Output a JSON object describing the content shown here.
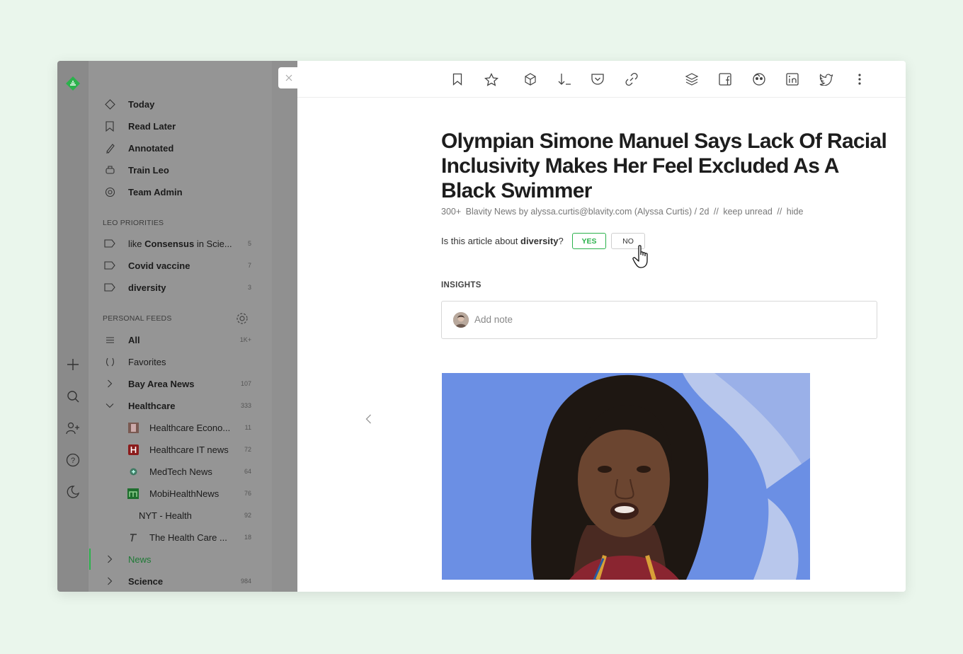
{
  "colors": {
    "accent": "#2bb24c",
    "page_bg": "#eaf6ec"
  },
  "rail": {
    "icons": [
      "feedly-logo-icon",
      "add-icon",
      "search-icon",
      "add-user-icon",
      "help-icon",
      "dark-mode-icon"
    ]
  },
  "sidebar": {
    "top_items": [
      {
        "label": "Today",
        "icon": "today-icon"
      },
      {
        "label": "Read Later",
        "icon": "bookmark-icon"
      },
      {
        "label": "Annotated",
        "icon": "highlighter-icon"
      },
      {
        "label": "Train Leo",
        "icon": "leo-icon"
      },
      {
        "label": "Team Admin",
        "icon": "team-icon"
      }
    ],
    "leo_priorities_title": "LEO PRIORITIES",
    "priorities": [
      {
        "prefix": "like ",
        "bold": "Consensus",
        "suffix": " in Scie...",
        "count": "5"
      },
      {
        "prefix": "",
        "bold": "Covid vaccine",
        "suffix": "",
        "count": "7"
      },
      {
        "prefix": "",
        "bold": "diversity",
        "suffix": "",
        "count": "3"
      }
    ],
    "personal_feeds_title": "PERSONAL FEEDS",
    "feeds": [
      {
        "label": "All",
        "count": "1K+"
      },
      {
        "label": "Favorites",
        "count": ""
      },
      {
        "label": "Bay Area News",
        "count": "107"
      },
      {
        "label": "Healthcare",
        "count": "333"
      },
      {
        "label": "Healthcare Econo...",
        "count": "11"
      },
      {
        "label": "Healthcare IT news",
        "count": "72"
      },
      {
        "label": "MedTech News",
        "count": "64"
      },
      {
        "label": "MobiHealthNews",
        "count": "76"
      },
      {
        "label": "NYT - Health",
        "count": "92"
      },
      {
        "label": "The Health Care ...",
        "count": "18"
      },
      {
        "label": "News",
        "count": ""
      },
      {
        "label": "Science",
        "count": "984"
      }
    ]
  },
  "toolbar": {
    "icons": [
      "bookmark-icon",
      "star-icon",
      "board-icon",
      "mark-read-icon",
      "pocket-icon",
      "link-icon",
      "buffer-icon",
      "facebook-icon",
      "hootsuite-icon",
      "linkedin-icon",
      "twitter-icon",
      "more-icon"
    ]
  },
  "article": {
    "title": "Olympian Simone Manuel Says Lack Of Racial Inclusivity Makes Her Feel Excluded As A Black Swimmer",
    "meta_count": "300+",
    "meta_source": "Blavity News by alyssa.curtis@blavity.com (Alyssa Curtis) / 2d",
    "meta_sep": "//",
    "keep_unread": "keep unread",
    "hide": "hide",
    "question_prefix": "Is this article about ",
    "question_topic": "diversity",
    "question_suffix": "?",
    "yes_label": "YES",
    "no_label": "NO",
    "insights_label": "INSIGHTS",
    "note_placeholder": "Add note"
  }
}
